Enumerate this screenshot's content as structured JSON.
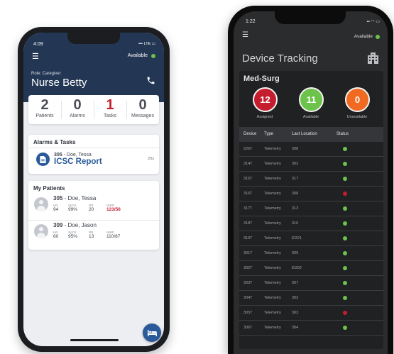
{
  "colors": {
    "nav_header": "#233754",
    "accent_blue": "#2a5a9a",
    "alarm_red": "#c41e2e",
    "available_green": "#6cc24a",
    "unavailable_orange": "#f06a22",
    "dark_bg": "#2b2c2e"
  },
  "caregiver_app": {
    "status_time": "4:09",
    "status_signal": "LTE",
    "menu_icon": "hamburger-menu-icon",
    "availability": "Available",
    "role": "Role: Caregiver",
    "name": "Nurse Betty",
    "phone_icon": "phone-icon",
    "stats": [
      {
        "value": "2",
        "label": "Patients"
      },
      {
        "value": "0",
        "label": "Alarms"
      },
      {
        "value": "1",
        "label": "Tasks"
      },
      {
        "value": "0",
        "label": "Messages"
      }
    ],
    "alarms_tasks": {
      "title": "Alarms & Tasks",
      "room": "305",
      "patient": " - Doe, Tessa",
      "task": "ICSC Report",
      "time": "20s"
    },
    "my_patients": {
      "title": "My Patients",
      "vital_labels": {
        "hr": "HR",
        "spo2": "SpO2",
        "rr": "RR",
        "nibp": "NIBP"
      },
      "patients": [
        {
          "room": "305",
          "name": " - Doe, Tessa",
          "hr": "94",
          "spo2": "99%",
          "rr": "20",
          "nibp": "123/56"
        },
        {
          "room": "309",
          "name": " - Doe, Jason",
          "hr": "60",
          "spo2": "95%",
          "rr": "13",
          "nibp": "110/87"
        }
      ]
    }
  },
  "tracking_app": {
    "status_time": "1:22",
    "availability": "Available",
    "title": "Device Tracking",
    "unit": "Med-Surg",
    "summary": [
      {
        "value": "12",
        "label": "Assigned",
        "color": "#c41e2e"
      },
      {
        "value": "11",
        "label": "Available",
        "color": "#6cc24a"
      },
      {
        "value": "0",
        "label": "Unavailable",
        "color": "#f06a22"
      }
    ],
    "columns": {
      "device": "Device",
      "type": "Type",
      "location": "Last Location",
      "status": "Status"
    },
    "rows": [
      {
        "device": "226T",
        "type": "Telemetry",
        "location": "308",
        "status": "green"
      },
      {
        "device": "314T",
        "type": "Telemetry",
        "location": "303",
        "status": "green"
      },
      {
        "device": "315T",
        "type": "Telemetry",
        "location": "317",
        "status": "green"
      },
      {
        "device": "316T",
        "type": "Telemetry",
        "location": "308",
        "status": "red"
      },
      {
        "device": "317T",
        "type": "Telemetry",
        "location": "313",
        "status": "green"
      },
      {
        "device": "318T",
        "type": "Telemetry",
        "location": "316",
        "status": "green"
      },
      {
        "device": "319T",
        "type": "Telemetry",
        "location": "ED01",
        "status": "green"
      },
      {
        "device": "301T",
        "type": "Telemetry",
        "location": "309",
        "status": "green"
      },
      {
        "device": "302T",
        "type": "Telemetry",
        "location": "ED02",
        "status": "green"
      },
      {
        "device": "303T",
        "type": "Telemetry",
        "location": "307",
        "status": "green"
      },
      {
        "device": "304T",
        "type": "Telemetry",
        "location": "303",
        "status": "green"
      },
      {
        "device": "305T",
        "type": "Telemetry",
        "location": "303",
        "status": "red"
      },
      {
        "device": "306T",
        "type": "Telemetry",
        "location": "304",
        "status": "green"
      }
    ]
  }
}
